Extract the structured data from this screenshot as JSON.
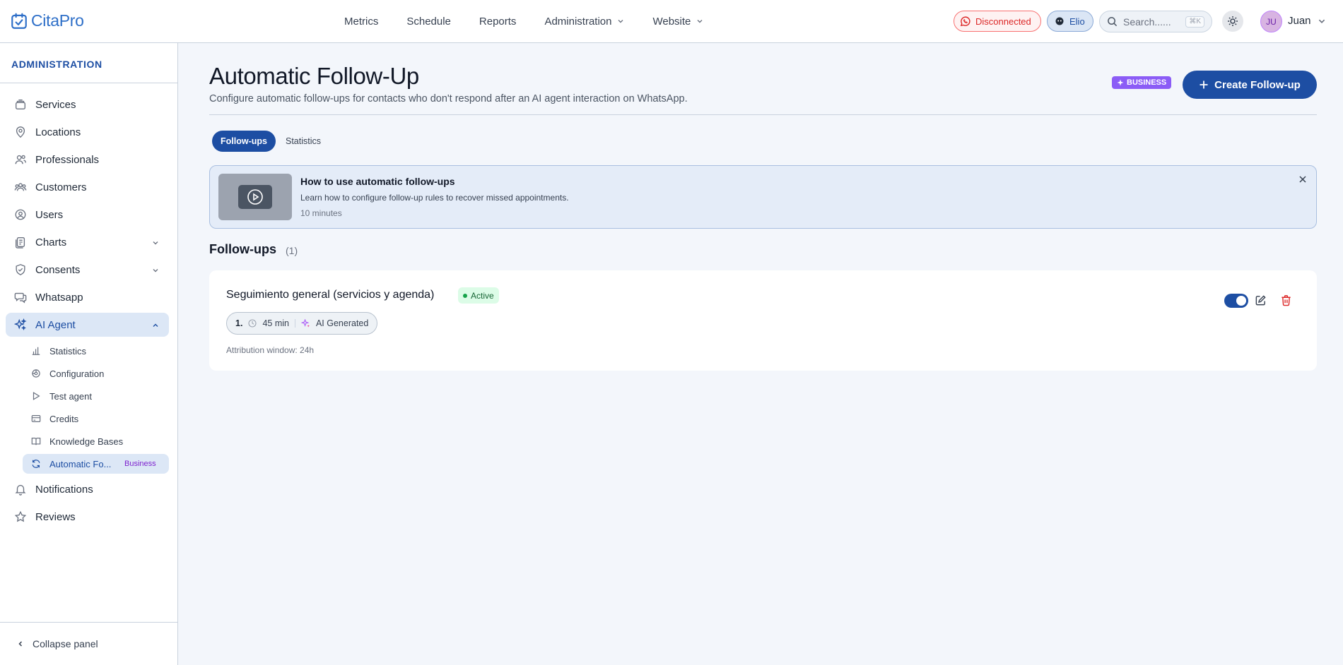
{
  "app": {
    "name": "CitaPro"
  },
  "topnav": {
    "items": [
      {
        "label": "Metrics",
        "has_dropdown": false
      },
      {
        "label": "Schedule",
        "has_dropdown": false
      },
      {
        "label": "Reports",
        "has_dropdown": false
      },
      {
        "label": "Administration",
        "has_dropdown": true
      },
      {
        "label": "Website",
        "has_dropdown": true
      }
    ],
    "whatsapp_status": "Disconnected",
    "agent_pill": "Elio",
    "search_placeholder": "Search......",
    "search_shortcut": "⌘K",
    "avatar_initials": "JU",
    "user_name": "Juan"
  },
  "sidebar": {
    "title": "ADMINISTRATION",
    "items": [
      {
        "label": "Services",
        "icon": "services-icon"
      },
      {
        "label": "Locations",
        "icon": "location-pin-icon"
      },
      {
        "label": "Professionals",
        "icon": "professionals-icon"
      },
      {
        "label": "Customers",
        "icon": "customers-icon"
      },
      {
        "label": "Users",
        "icon": "users-icon"
      },
      {
        "label": "Charts",
        "icon": "charts-icon",
        "expandable": true
      },
      {
        "label": "Consents",
        "icon": "shield-check-icon",
        "expandable": true
      },
      {
        "label": "Whatsapp",
        "icon": "chat-bubbles-icon"
      },
      {
        "label": "AI Agent",
        "icon": "sparkles-icon",
        "expanded": true,
        "active": true
      }
    ],
    "subitems": [
      {
        "label": "Statistics",
        "icon": "bar-chart-icon"
      },
      {
        "label": "Configuration",
        "icon": "settings-icon"
      },
      {
        "label": "Test agent",
        "icon": "play-icon"
      },
      {
        "label": "Credits",
        "icon": "credit-card-icon"
      },
      {
        "label": "Knowledge Bases",
        "icon": "book-icon"
      },
      {
        "label": "Automatic Fo...",
        "icon": "refresh-icon",
        "active": true,
        "tag": "Business"
      }
    ],
    "bottom_items": [
      {
        "label": "Notifications",
        "icon": "bell-icon"
      },
      {
        "label": "Reviews",
        "icon": "star-icon"
      }
    ],
    "collapse_label": "Collapse panel"
  },
  "page": {
    "title": "Automatic Follow-Up",
    "subtitle": "Configure automatic follow-ups for contacts who don't respond after an AI agent interaction on WhatsApp.",
    "plan_badge": "BUSINESS",
    "create_button": "Create Follow-up",
    "tabs": [
      {
        "label": "Follow-ups",
        "active": true
      },
      {
        "label": "Statistics",
        "active": false
      }
    ],
    "info_card": {
      "title": "How to use automatic follow-ups",
      "description": "Learn how to configure follow-up rules to recover missed appointments.",
      "duration": "10 minutes"
    },
    "section": {
      "title": "Follow-ups",
      "count": "(1)"
    },
    "followups": [
      {
        "name": "Seguimiento general (servicios y agenda)",
        "status": "Active",
        "steps": [
          {
            "number": "1.",
            "delay": "45 min",
            "mode": "AI Generated"
          }
        ],
        "attribution": "Attribution window: 24h",
        "enabled": true
      }
    ]
  },
  "colors": {
    "primary": "#1d4ea3",
    "accent_purple": "#8b5cf6",
    "danger": "#dc2626",
    "success": "#16a34a",
    "background": "#f3f6fb"
  }
}
